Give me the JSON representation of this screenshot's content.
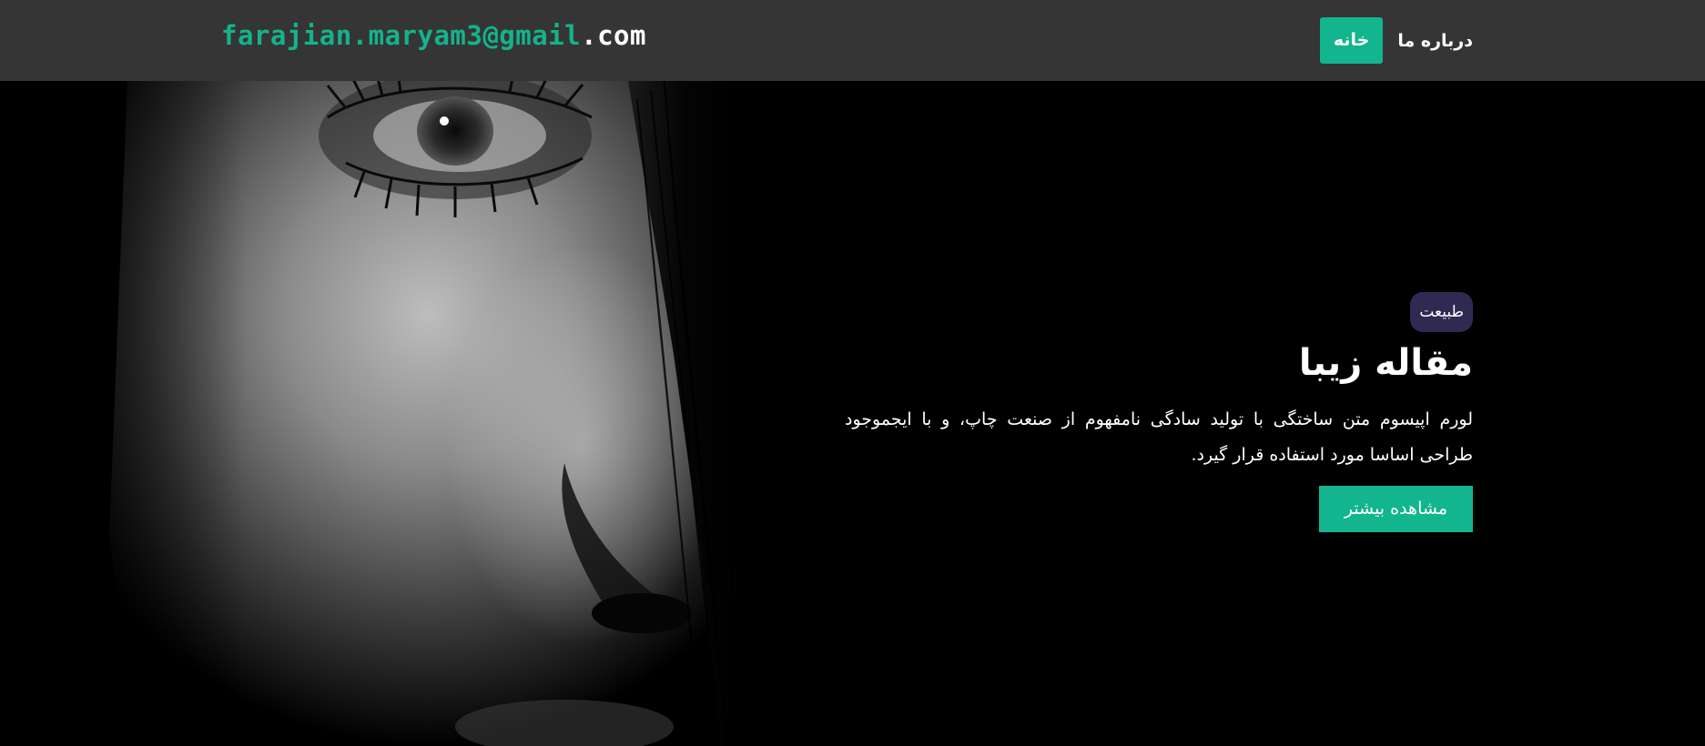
{
  "nav": {
    "brand_main": "farajian.maryam3@gmail",
    "brand_tld": ".com",
    "links": [
      {
        "label": "خانه",
        "active": true
      },
      {
        "label": "درباره ما",
        "active": false
      }
    ]
  },
  "hero": {
    "category": "طبیعت",
    "title": "مقاله زیبا",
    "description": "لورم اپیسوم متن ساختگی با تولید سادگی نامفهوم از صنعت چاپ، و با ایجموجود طراحی اساسا مورد استفاده قرار گیرد.",
    "cta_label": "مشاهده بیشتر"
  },
  "colors": {
    "navbar_bg": "#353535",
    "accent": "#12b58d",
    "badge_bg": "#2e2a52",
    "hero_bg": "#000000"
  }
}
